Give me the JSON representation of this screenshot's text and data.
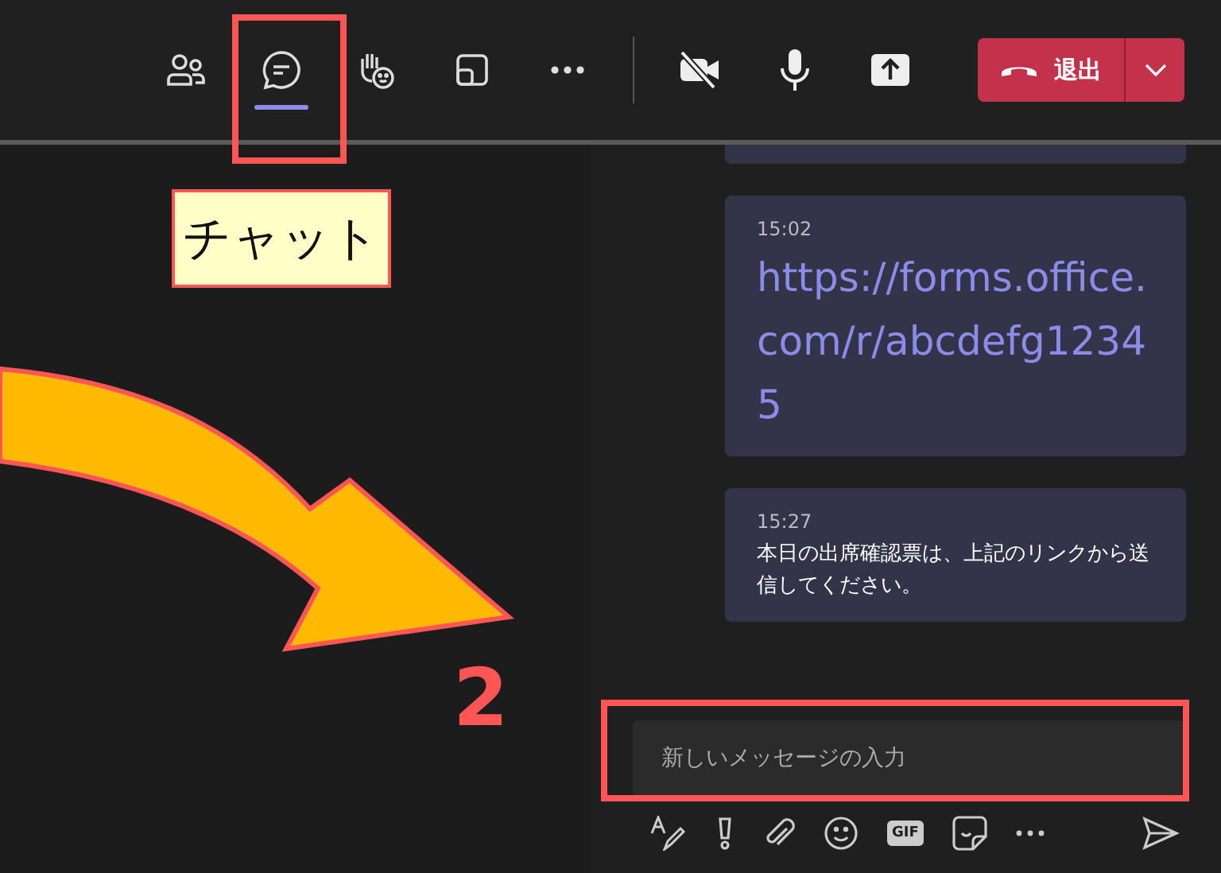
{
  "toolbar": {
    "buttons": [
      {
        "kind": "people",
        "selected": false
      },
      {
        "kind": "chat",
        "selected": true
      },
      {
        "kind": "react",
        "selected": false
      },
      {
        "kind": "rooms",
        "selected": false
      },
      {
        "kind": "more",
        "selected": false
      }
    ],
    "devices": [
      {
        "kind": "camera-off"
      },
      {
        "kind": "mic"
      },
      {
        "kind": "share"
      }
    ],
    "leave_button": {
      "label": "退出"
    }
  },
  "messages": [
    {
      "kind": "partial"
    },
    {
      "kind": "link",
      "time": "15:02",
      "text": "https://forms.office.com/r/abcdefg12345"
    },
    {
      "kind": "text",
      "time": "15:27",
      "text": "本日の出席確認票は、上記のリンクから送信してください。"
    }
  ],
  "composer": {
    "placeholder": "新しいメッセージの入力"
  },
  "compose_tools": [
    {
      "kind": "format"
    },
    {
      "kind": "important"
    },
    {
      "kind": "attach"
    },
    {
      "kind": "emoji"
    },
    {
      "kind": "gif",
      "label": "GIF"
    },
    {
      "kind": "sticker"
    },
    {
      "kind": "more"
    }
  ],
  "annotations": {
    "callout": "チャット",
    "step": "2"
  }
}
